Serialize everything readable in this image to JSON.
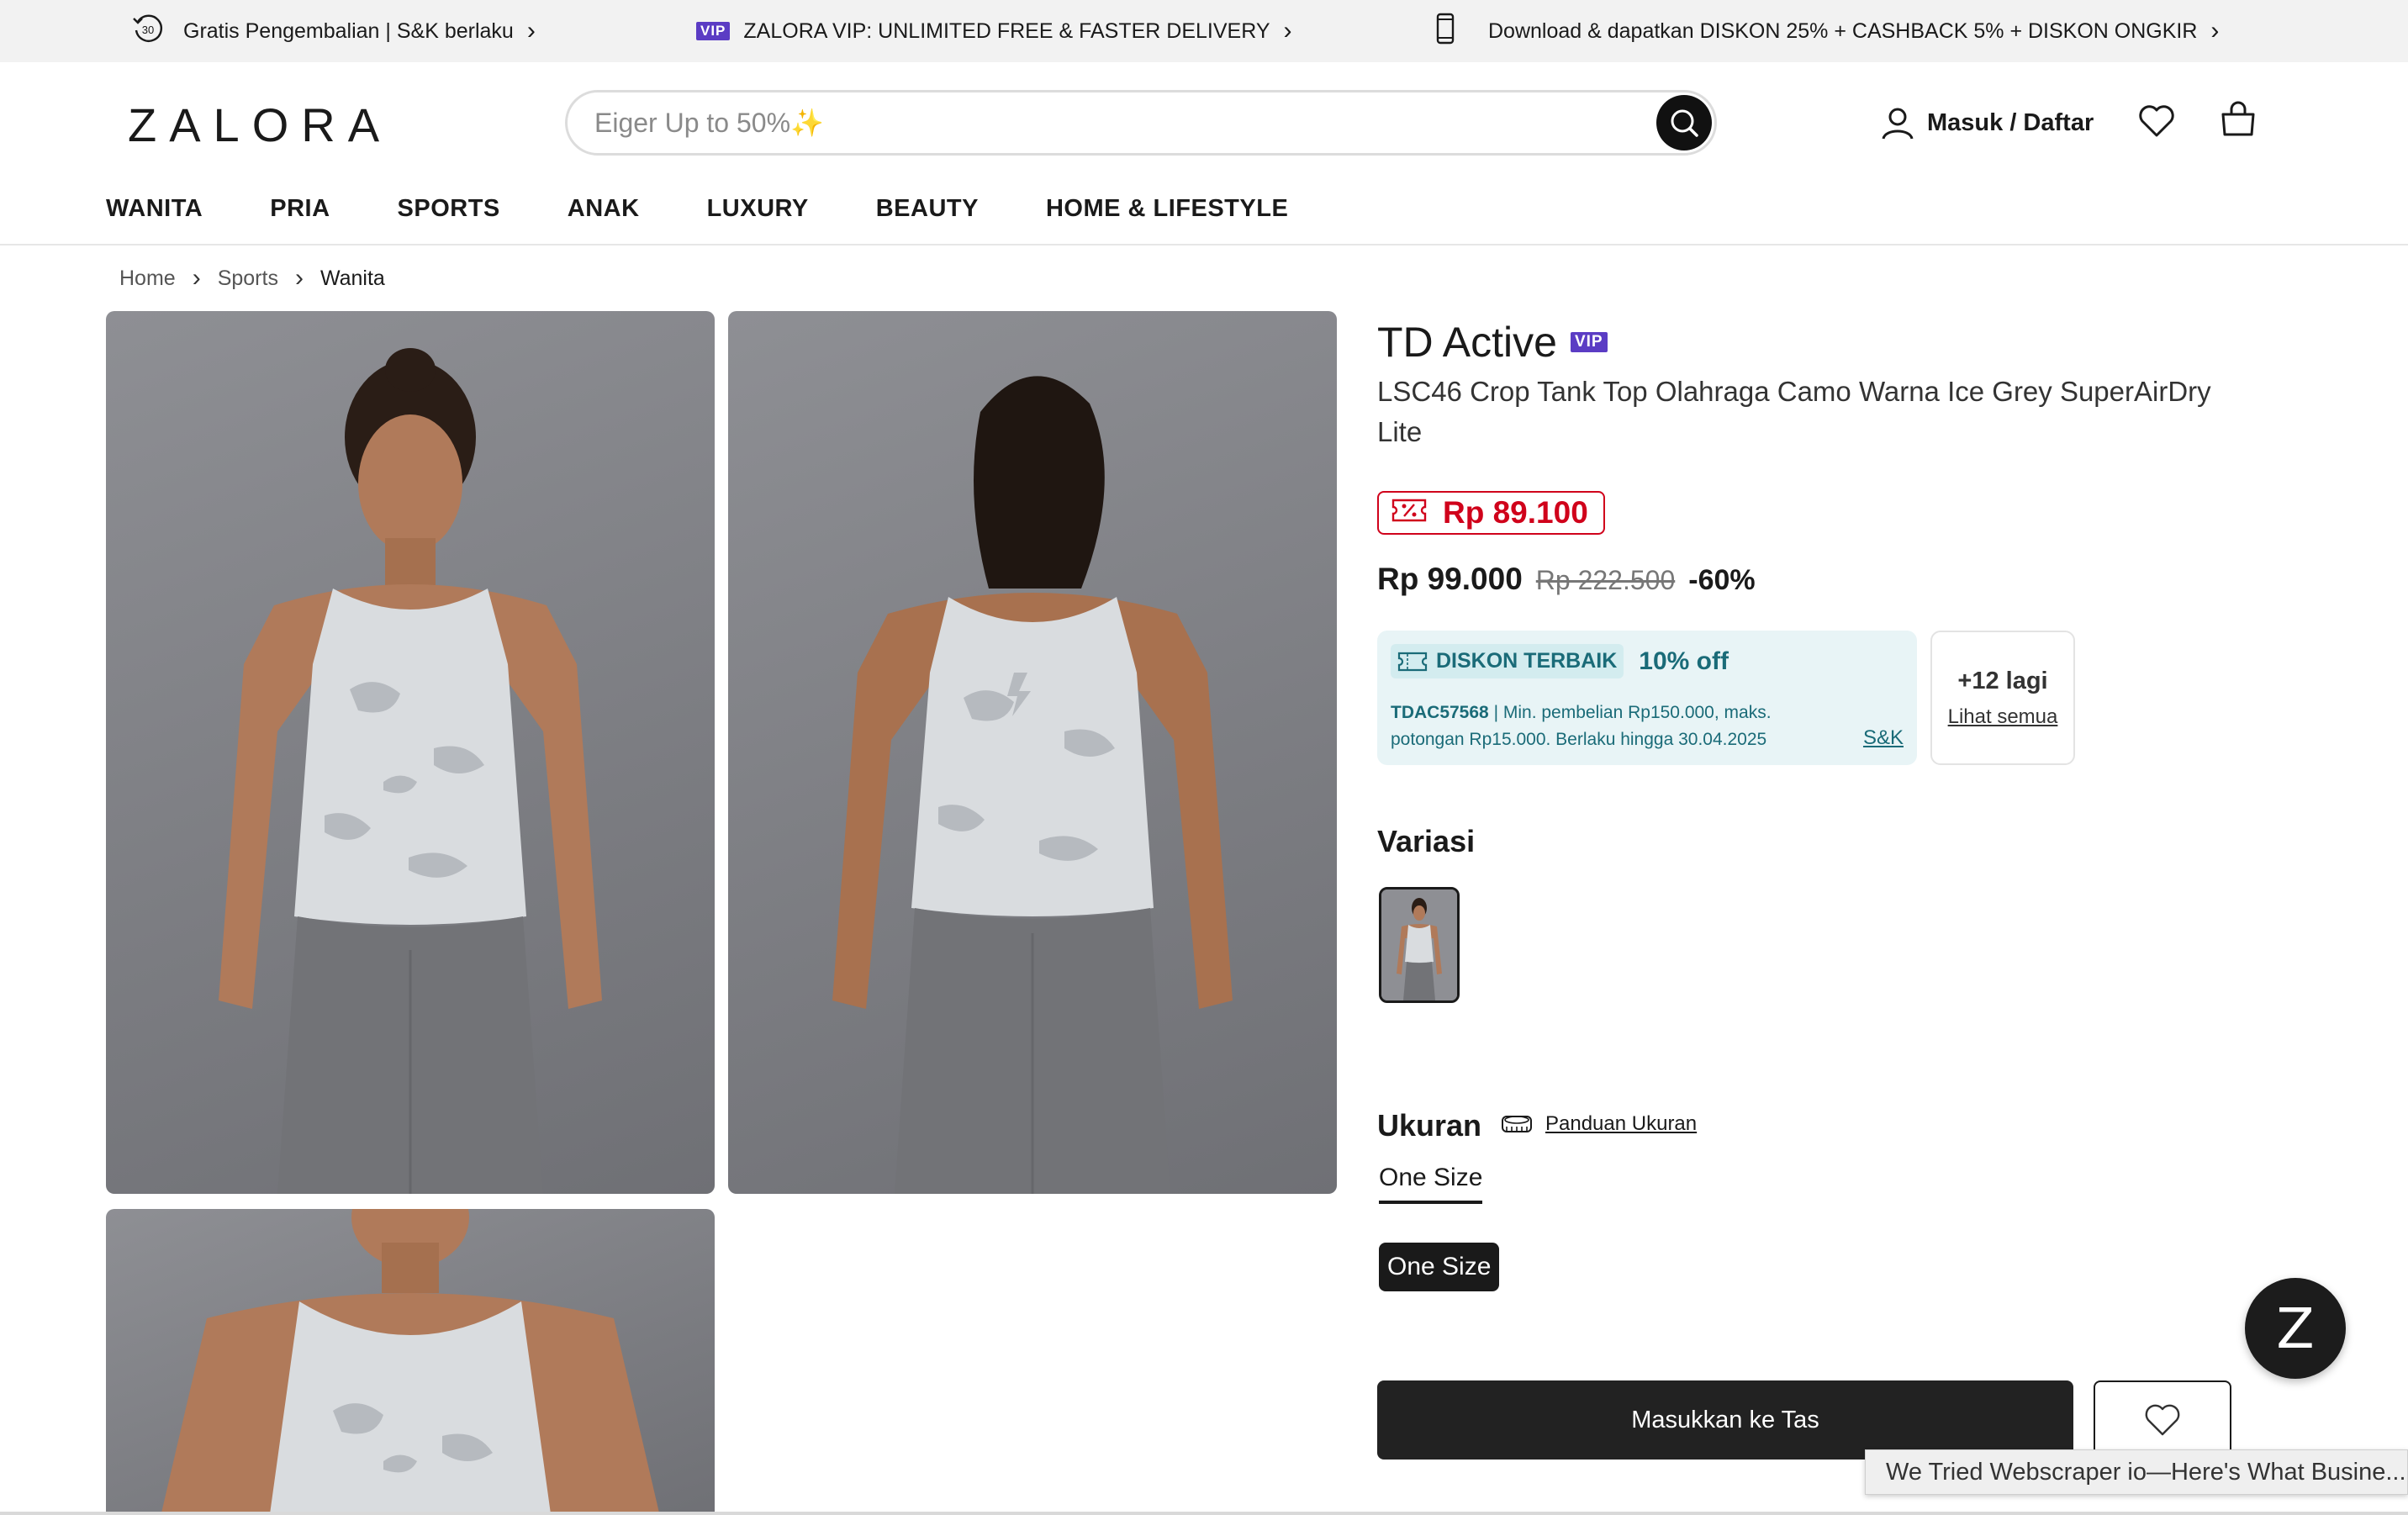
{
  "promo_bar": {
    "returns_text": "Gratis Pengembalian | S&K berlaku",
    "vip_badge": "VIP",
    "vip_text": "ZALORA VIP: UNLIMITED FREE & FASTER DELIVERY",
    "app_text": "Download & dapatkan DISKON 25% + CASHBACK 5% + DISKON ONGKIR",
    "returns_icon_text": "30",
    "chevron": "›"
  },
  "header": {
    "logo": "ZALORA",
    "search_placeholder": "Eiger Up to 50%✨",
    "login_label": "Masuk / Daftar"
  },
  "nav": {
    "items": [
      "WANITA",
      "PRIA",
      "SPORTS",
      "ANAK",
      "LUXURY",
      "BEAUTY",
      "HOME & LIFESTYLE"
    ]
  },
  "breadcrumb": {
    "items": [
      "Home",
      "Sports",
      "Wanita"
    ],
    "separator": "›"
  },
  "product": {
    "brand": "TD Active",
    "vip_badge": "VIP",
    "name": "LSC46 Crop Tank Top Olahraga Camo Warna Ice Grey SuperAirDry Lite",
    "voucher_price": "Rp 89.100",
    "price": "Rp 99.000",
    "original_price": "Rp 222.500",
    "discount": "-60%"
  },
  "deal": {
    "tag": "DISKON TERBAIK",
    "percent": "10% off",
    "code": "TDAC57568",
    "desc": " | Min. pembelian Rp150.000, maks. potongan Rp15.000. Berlaku hingga 30.04.2025",
    "terms": "S&K",
    "more_count": "+12 lagi",
    "more_link": "Lihat semua"
  },
  "variants": {
    "title": "Variasi"
  },
  "size": {
    "title": "Ukuran",
    "guide": "Panduan Ukuran",
    "tab": "One Size",
    "option": "One Size"
  },
  "actions": {
    "add_to_bag": "Masukkan ke Tas"
  },
  "chat": {
    "label": "Z"
  },
  "tooltip": {
    "text": "We Tried Webscraper io—Here's What Busine...rs"
  },
  "colors": {
    "accent_red": "#d0021b",
    "vip_purple": "#5b3cc4",
    "deal_teal": "#1a6b78",
    "deal_bg": "#e8f4f6"
  }
}
